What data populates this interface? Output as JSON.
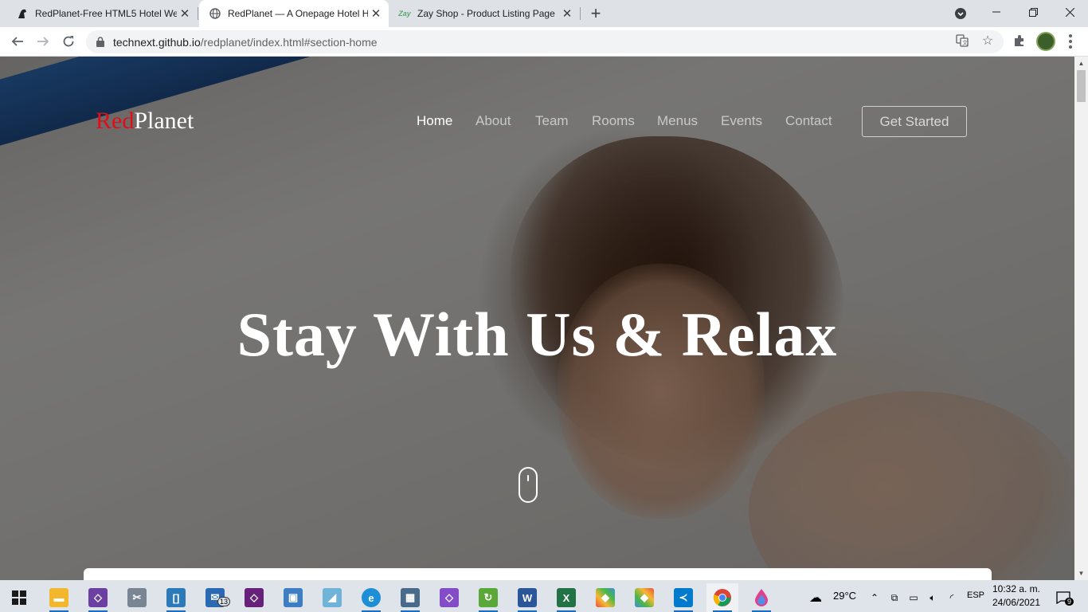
{
  "browser": {
    "tabs": [
      {
        "title": "RedPlanet-Free HTML5 Hotel We",
        "favicon": "horse-icon",
        "active": false
      },
      {
        "title": "RedPlanet — A Onepage Hotel H",
        "favicon": "globe-icon",
        "active": true
      },
      {
        "title": "Zay Shop - Product Listing Page",
        "favicon": "zay-logo",
        "favicon_text": "Zay",
        "active": false
      }
    ],
    "url": {
      "host": "technext.github.io",
      "path": "/redplanet/index.html#section-home"
    }
  },
  "site": {
    "logo": {
      "part1": "Red",
      "part2": "Planet"
    },
    "nav": [
      {
        "label": "Home",
        "active": true
      },
      {
        "label": "About",
        "active": false
      },
      {
        "label": "Team",
        "active": false
      },
      {
        "label": "Rooms",
        "active": false
      },
      {
        "label": "Menus",
        "active": false
      },
      {
        "label": "Events",
        "active": false
      },
      {
        "label": "Contact",
        "active": false
      }
    ],
    "cta": "Get Started",
    "headline": "Stay With Us & Relax"
  },
  "taskbar": {
    "apps": [
      "start-icon",
      "file-explorer-icon",
      "visual-studio-icon",
      "snipping-tool-icon",
      "notepad-plus-icon",
      "mail-icon",
      "visual-studio-alt-icon",
      "image-viewer-icon",
      "blue-app-icon",
      "edge-icon",
      "server-app-icon",
      "visual-studio-purple-icon",
      "recycle-app-icon",
      "word-icon",
      "excel-icon",
      "colorful-app-icon",
      "colorful-app-2-icon",
      "vscode-icon",
      "chrome-icon",
      "paint-drop-icon"
    ],
    "mail_badge": "13",
    "weather": "29°C",
    "language": "ESP",
    "time": "10:32 a. m.",
    "date": "24/06/2021",
    "notification_count": "9"
  },
  "colors": {
    "brand_red": "#e20d17",
    "tab_strip": "#dee1e6",
    "accent_blue": "#1b6ec2"
  }
}
